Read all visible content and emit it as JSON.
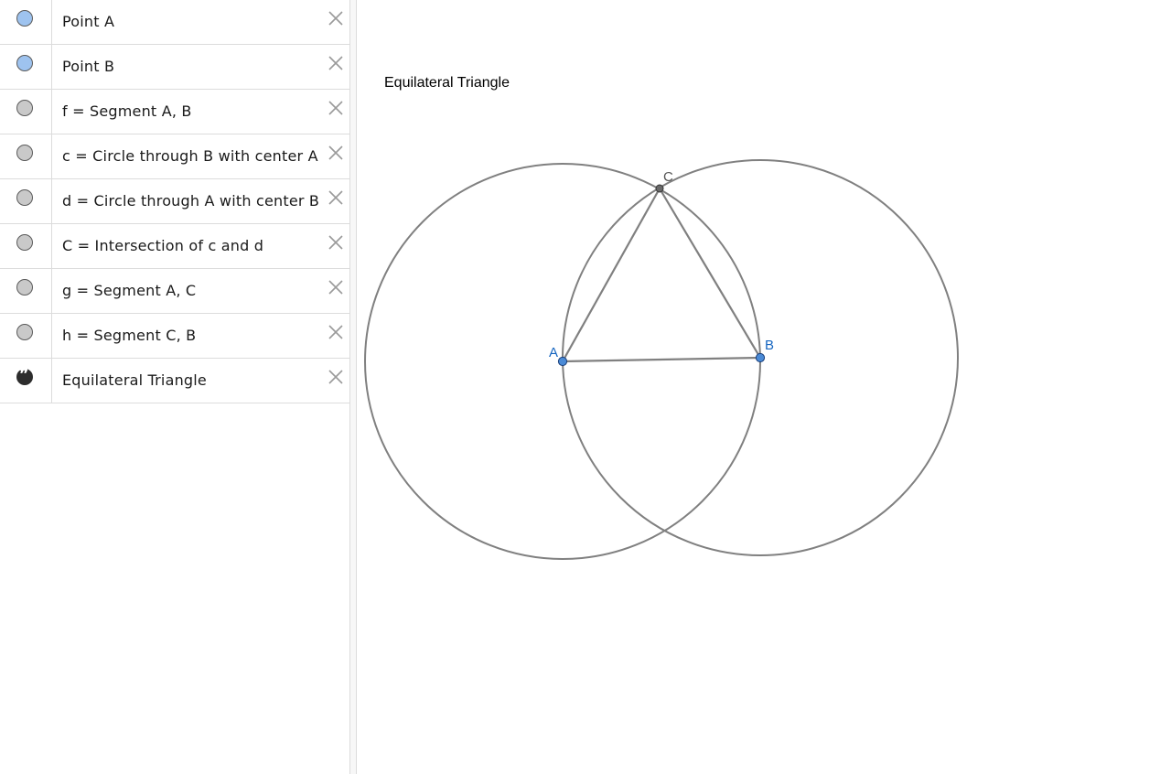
{
  "algebra": {
    "items": [
      {
        "label": "Point A",
        "marble_color": "#9ec3ef",
        "kind": "point"
      },
      {
        "label": "Point B",
        "marble_color": "#9ec3ef",
        "kind": "point"
      },
      {
        "label": "f = Segment A, B",
        "marble_color": "#c9c9c9",
        "kind": "segment"
      },
      {
        "label": "c = Circle through B with center A",
        "marble_color": "#c9c9c9",
        "kind": "circle"
      },
      {
        "label": "d = Circle through A with center B",
        "marble_color": "#c9c9c9",
        "kind": "circle"
      },
      {
        "label": "C = Intersection of c and d",
        "marble_color": "#c9c9c9",
        "kind": "point"
      },
      {
        "label": "g = Segment A, C",
        "marble_color": "#c9c9c9",
        "kind": "segment"
      },
      {
        "label": "h = Segment C, B",
        "marble_color": "#c9c9c9",
        "kind": "segment"
      },
      {
        "label": "Equilateral Triangle",
        "marble_color": "#2d2d2d",
        "kind": "text"
      }
    ],
    "quote_glyph": "❞"
  },
  "graphics": {
    "text_object": "Equilateral Triangle",
    "points": {
      "A": {
        "label": "A",
        "color": "#1565c0"
      },
      "B": {
        "label": "B",
        "color": "#1565c0"
      },
      "C": {
        "label": "C",
        "color": "#555555"
      }
    },
    "stroke_color": "#808080",
    "point_fill_free": "#4a8ad6",
    "point_fill_dependent": "#6a6a6a"
  },
  "icons": {
    "delete": "close-icon",
    "visibility": "marble-icon"
  }
}
